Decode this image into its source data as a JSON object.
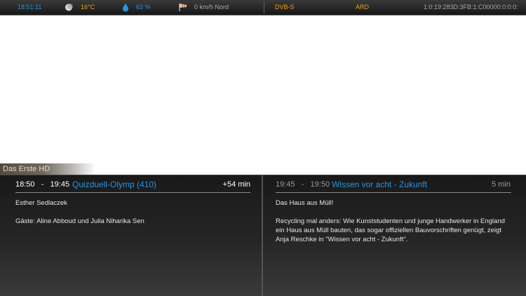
{
  "statusbar": {
    "clock": "18:51:11",
    "weather_icon": "moon-icon",
    "temperature": "16°C",
    "humidity_icon": "water-drop-icon",
    "humidity": "63 %",
    "wind_icon": "windsock-icon",
    "wind": "0 km/h Nord",
    "tuner": "DVB-S",
    "provider": "ARD",
    "service_ref": "1:0:19:283D:3FB:1:C00000:0:0:0:"
  },
  "channel": {
    "name": "Das Erste HD"
  },
  "now": {
    "start": "18:50",
    "end": "19:45",
    "title": "Quizduell-Olymp (410)",
    "remaining": "+54 min",
    "short_desc": "Esther Sedlaczek",
    "description": "Gäste: Aline Abboud und Julia Niharika Sen"
  },
  "next": {
    "start": "19:45",
    "end": "19:50",
    "title": "Wissen vor acht - Zukunft",
    "duration": "5 min",
    "short_desc": "Das Haus aus Müll!",
    "description": "Recycling mal anders: Wie Kunststudenten und junge Handwerker in England ein Haus aus Müll bauten, das sogar offiziellen Bauvorschriften genügt, zeigt Anja Reschke in \"Wissen vor acht - Zukunft\"."
  },
  "colors": {
    "accent_blue": "#2a93e0",
    "accent_orange": "#f0a020",
    "panel_bg": "#1f1f1f"
  }
}
